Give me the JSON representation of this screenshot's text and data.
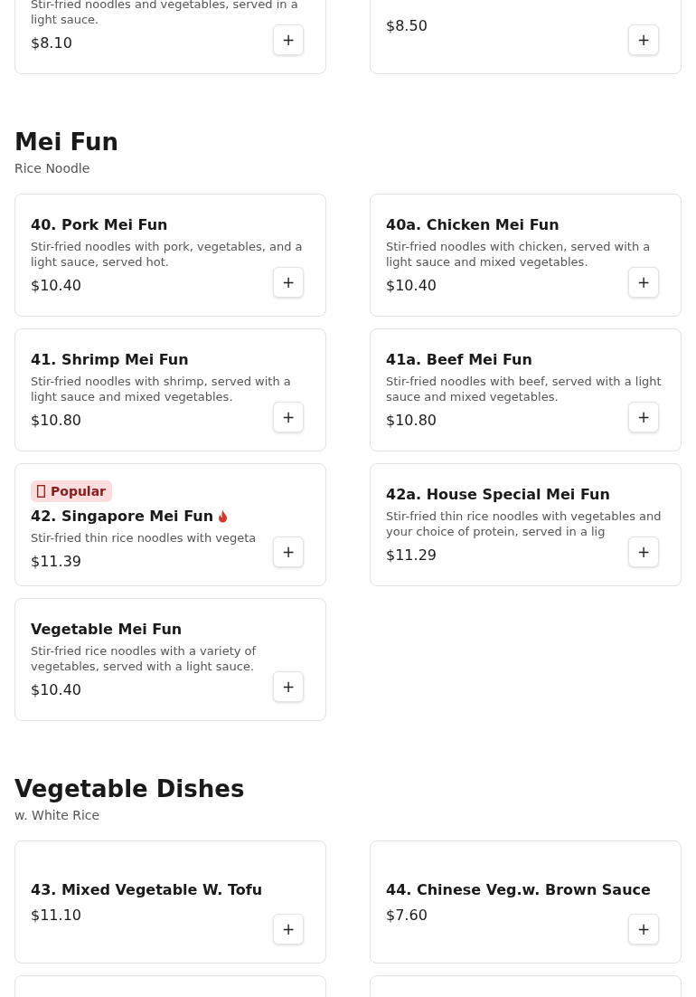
{
  "sections": [
    {
      "items": [
        {
          "kind": "dish",
          "description": "Stir-fried noodles and vegetables, served in a light sauce.",
          "price": "$8.10",
          "add": "+"
        },
        {
          "kind": "dish",
          "price": "$8.50",
          "add": "+"
        }
      ]
    },
    {
      "title": "Mei Fun",
      "subtitle": "Rice Noodle",
      "items": [
        {
          "kind": "dish",
          "title": "40. Pork Mei Fun",
          "description": "Stir-fried noodles with pork, vegetables, and a light sauce, served hot.",
          "price": "$10.40",
          "add": "+"
        },
        {
          "kind": "dish",
          "title": "40a. Chicken Mei Fun",
          "description": "Stir-fried noodles with chicken, served with a light sauce and mixed vegetables.",
          "price": "$10.40",
          "add": "+"
        },
        {
          "kind": "dish",
          "title": "41. Shrimp Mei Fun",
          "description": "Stir-fried noodles with shrimp, served with a light sauce and mixed vegetables.",
          "price": "$10.80",
          "add": "+"
        },
        {
          "kind": "dish",
          "title": "41a. Beef Mei Fun",
          "description": "Stir-fried noodles with beef, served with a light sauce and mixed vegetables.",
          "price": "$10.80",
          "add": "+"
        },
        {
          "kind": "dish",
          "badge": "Popular",
          "title": "42. Singapore Mei Fun",
          "spicy": true,
          "description": "Stir-fried thin rice noodles with vegeta",
          "price": "$11.39",
          "add": "+"
        },
        {
          "kind": "dish",
          "title": "42a. House Special Mei Fun",
          "description": "Stir-fried thin rice noodles with vegetables and your choice of protein, served in a lig",
          "price": "$11.29",
          "add": "+"
        },
        {
          "kind": "dish",
          "title": "Vegetable Mei Fun",
          "description": "Stir-fried rice noodles with a variety of vegetables, served with a light sauce.",
          "price": "$10.40",
          "add": "+"
        }
      ]
    },
    {
      "title": "Vegetable Dishes",
      "subtitle": "w. White Rice",
      "items": [
        {
          "kind": "dish",
          "title": "43. Mixed Vegetable W. Tofu",
          "price": "$11.10",
          "add": "+"
        },
        {
          "kind": "dish",
          "title": "44. Chinese Veg.w. Brown Sauce",
          "price": "$7.60",
          "add": "+"
        },
        {
          "kind": "cut-off"
        },
        {
          "kind": "cut-off"
        }
      ]
    }
  ]
}
